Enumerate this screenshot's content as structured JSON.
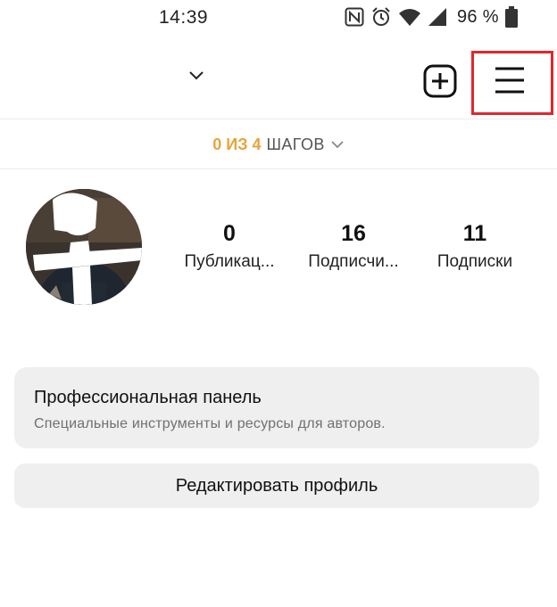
{
  "status_bar": {
    "time": "14:39",
    "battery_percent": "96 %",
    "icons": [
      "nfc-icon",
      "alarm-icon",
      "wifi-icon",
      "signal-icon",
      "battery-icon"
    ]
  },
  "header": {
    "username": "",
    "icons": {
      "add": "plus-square-icon",
      "menu": "hamburger-menu-icon"
    },
    "highlight_color": "#e0262d"
  },
  "steps": {
    "count": "0 ИЗ 4",
    "label": "ШАГОВ",
    "accent_color": "#e8a33a"
  },
  "profile": {
    "stats": [
      {
        "value": "0",
        "label": "Публикац..."
      },
      {
        "value": "16",
        "label": "Подписчи..."
      },
      {
        "value": "11",
        "label": "Подписки"
      }
    ]
  },
  "pro_panel": {
    "title": "Профессиональная панель",
    "subtitle": "Специальные инструменты и ресурсы для авторов."
  },
  "edit_profile": {
    "label": "Редактировать профиль"
  }
}
